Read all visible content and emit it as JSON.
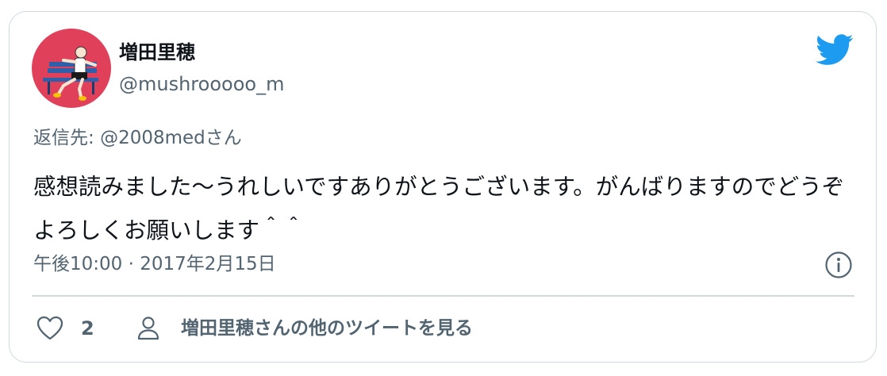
{
  "tweet": {
    "author": {
      "display_name": "増田里穂",
      "handle": "@mushrooooo_m",
      "avatar_bg": "#e0405a"
    },
    "reply": {
      "prefix": "返信先: ",
      "handle": "@2008med",
      "suffix": "さん"
    },
    "text": "感想読みました〜うれしいですありがとうございます。がんばりますのでどうぞよろしくお願いします＾＾",
    "timestamp": "午後10:00 · 2017年2月15日",
    "actions": {
      "like_count": "2",
      "more_tweets_label": "増田里穂さんの他のツイートを見る"
    }
  },
  "icons": {
    "brand": "twitter-bird-icon",
    "info": "info-icon",
    "like": "heart-icon",
    "profile": "person-icon"
  },
  "colors": {
    "brand": "#1d9bf0",
    "text_primary": "#0f1419",
    "text_secondary": "#536471",
    "border": "#cfd9de"
  }
}
